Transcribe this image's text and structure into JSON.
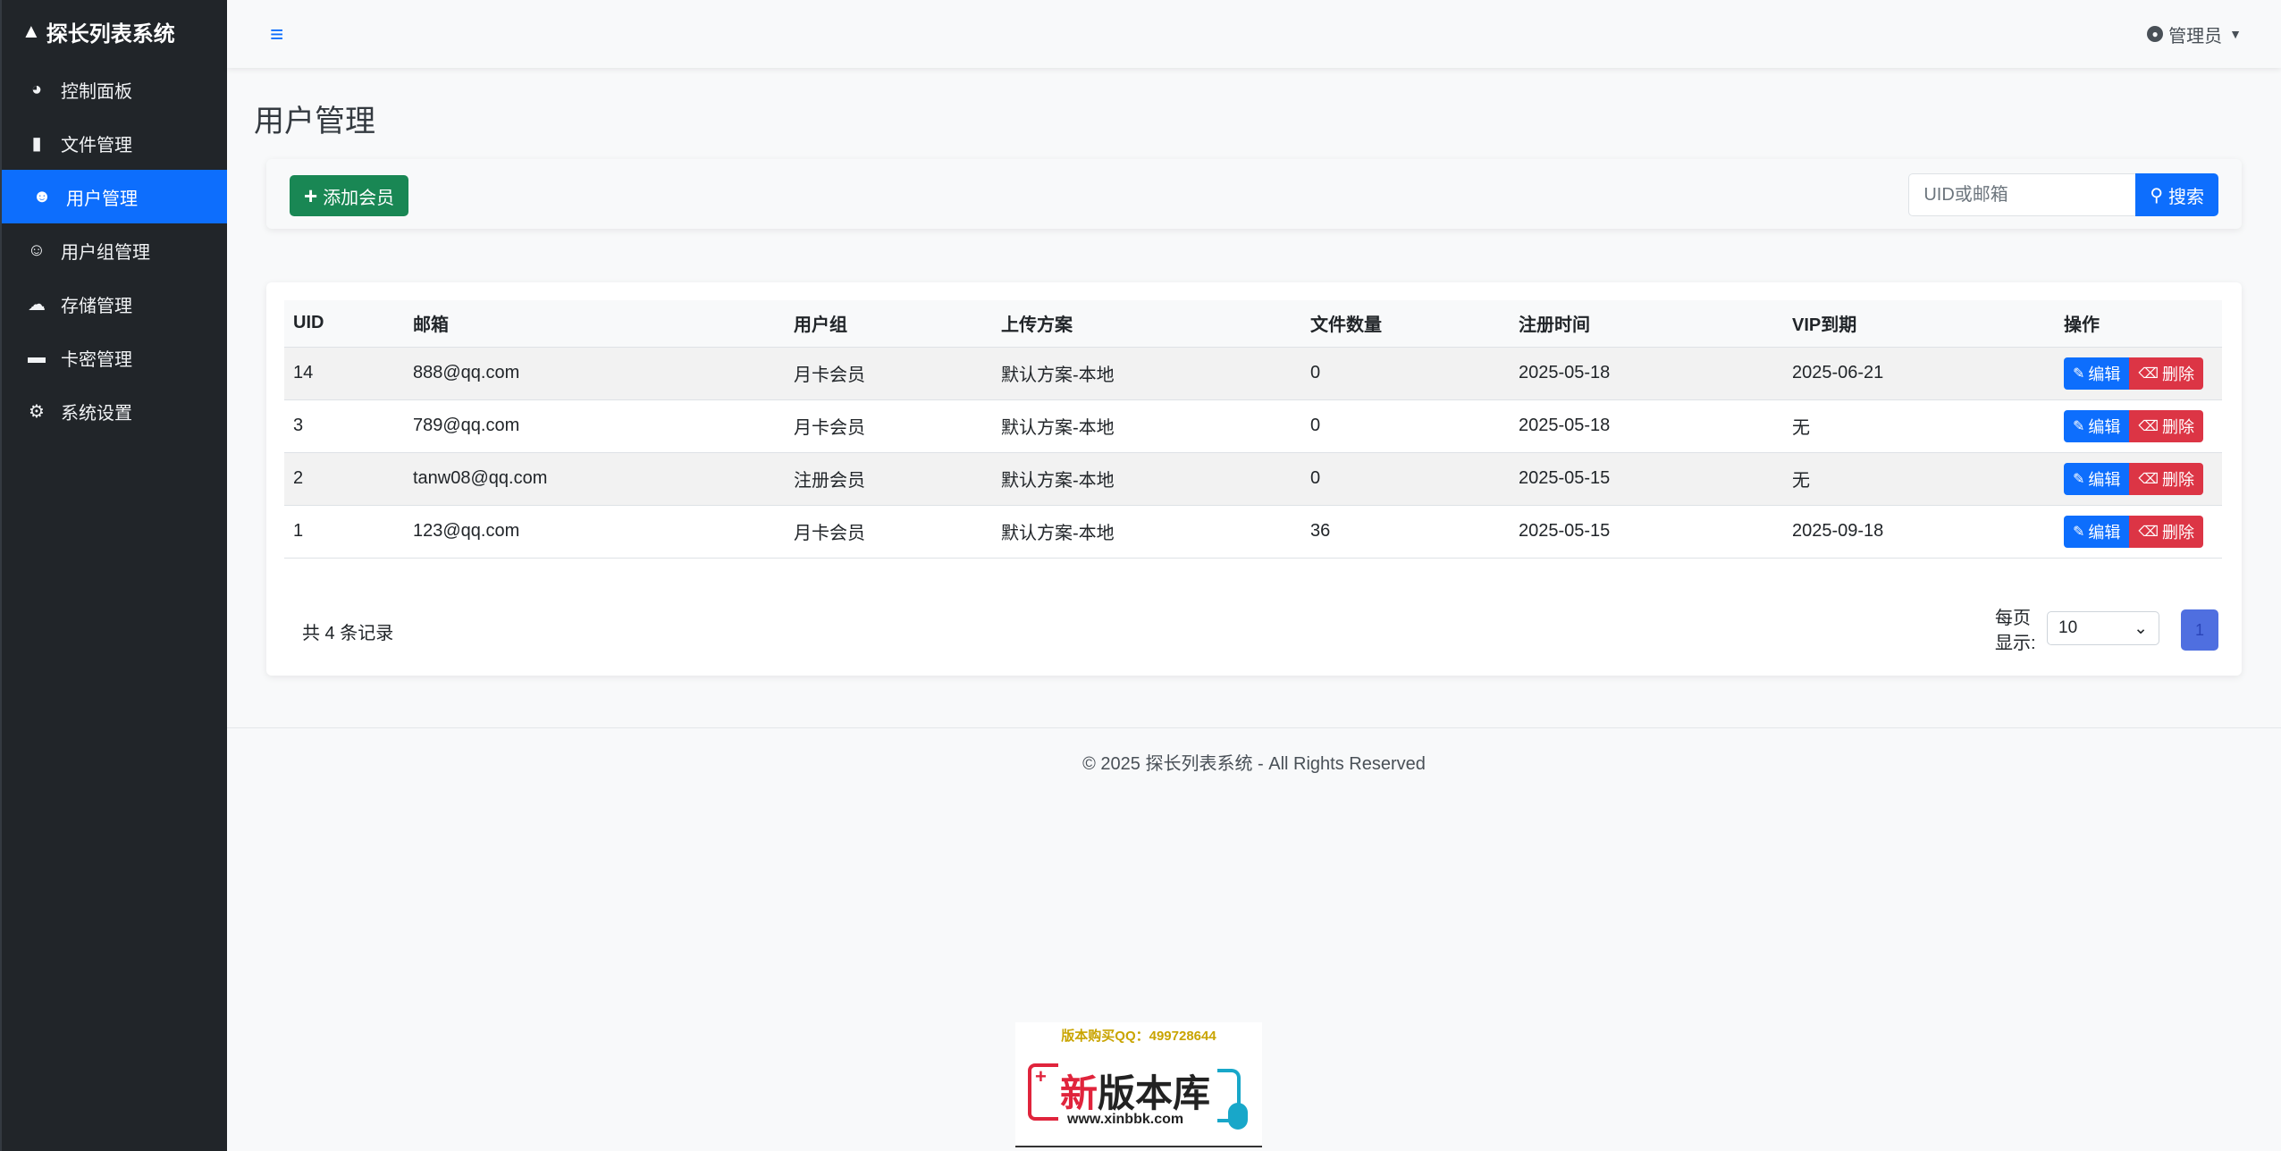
{
  "brand": {
    "title": "探长列表系统"
  },
  "sidebar": {
    "items": [
      {
        "label": "控制面板",
        "icon": "speedometer-icon"
      },
      {
        "label": "文件管理",
        "icon": "file-icon"
      },
      {
        "label": "用户管理",
        "icon": "users-icon",
        "active": true
      },
      {
        "label": "用户组管理",
        "icon": "user-group-icon"
      },
      {
        "label": "存储管理",
        "icon": "cloud-upload-icon"
      },
      {
        "label": "卡密管理",
        "icon": "credit-card-icon"
      },
      {
        "label": "系统设置",
        "icon": "gear-icon"
      }
    ]
  },
  "header": {
    "user_label": "管理员"
  },
  "page": {
    "title": "用户管理"
  },
  "toolbar": {
    "add_label": "添加会员",
    "search_placeholder": "UID或邮箱",
    "search_label": "搜索"
  },
  "table": {
    "columns": [
      "UID",
      "邮箱",
      "用户组",
      "上传方案",
      "文件数量",
      "注册时间",
      "VIP到期",
      "操作"
    ],
    "rows": [
      [
        "14",
        "888@qq.com",
        "月卡会员",
        "默认方案-本地",
        "0",
        "2025-05-18",
        "2025-06-21"
      ],
      [
        "3",
        "789@qq.com",
        "月卡会员",
        "默认方案-本地",
        "0",
        "2025-05-18",
        "无"
      ],
      [
        "2",
        "tanw08@qq.com",
        "注册会员",
        "默认方案-本地",
        "0",
        "2025-05-15",
        "无"
      ],
      [
        "1",
        "123@qq.com",
        "月卡会员",
        "默认方案-本地",
        "36",
        "2025-05-15",
        "2025-09-18"
      ]
    ],
    "edit_label": "编辑",
    "delete_label": "删除"
  },
  "pagination": {
    "total_text": "共 4 条记录",
    "per_page_label": "每页显示:",
    "per_page_value": "10",
    "current_page": "1"
  },
  "footer": {
    "text": "© 2025 探长列表系统 - All Rights Reserved"
  },
  "watermark": {
    "qq_text": "版本购买QQ：499728644",
    "name_red": "新",
    "name_rest": "版本库",
    "url": "www.xinbbk.com"
  },
  "colors": {
    "sidebar_bg": "#212529",
    "primary": "#0d6efd",
    "success": "#198754",
    "danger": "#dc3545"
  }
}
